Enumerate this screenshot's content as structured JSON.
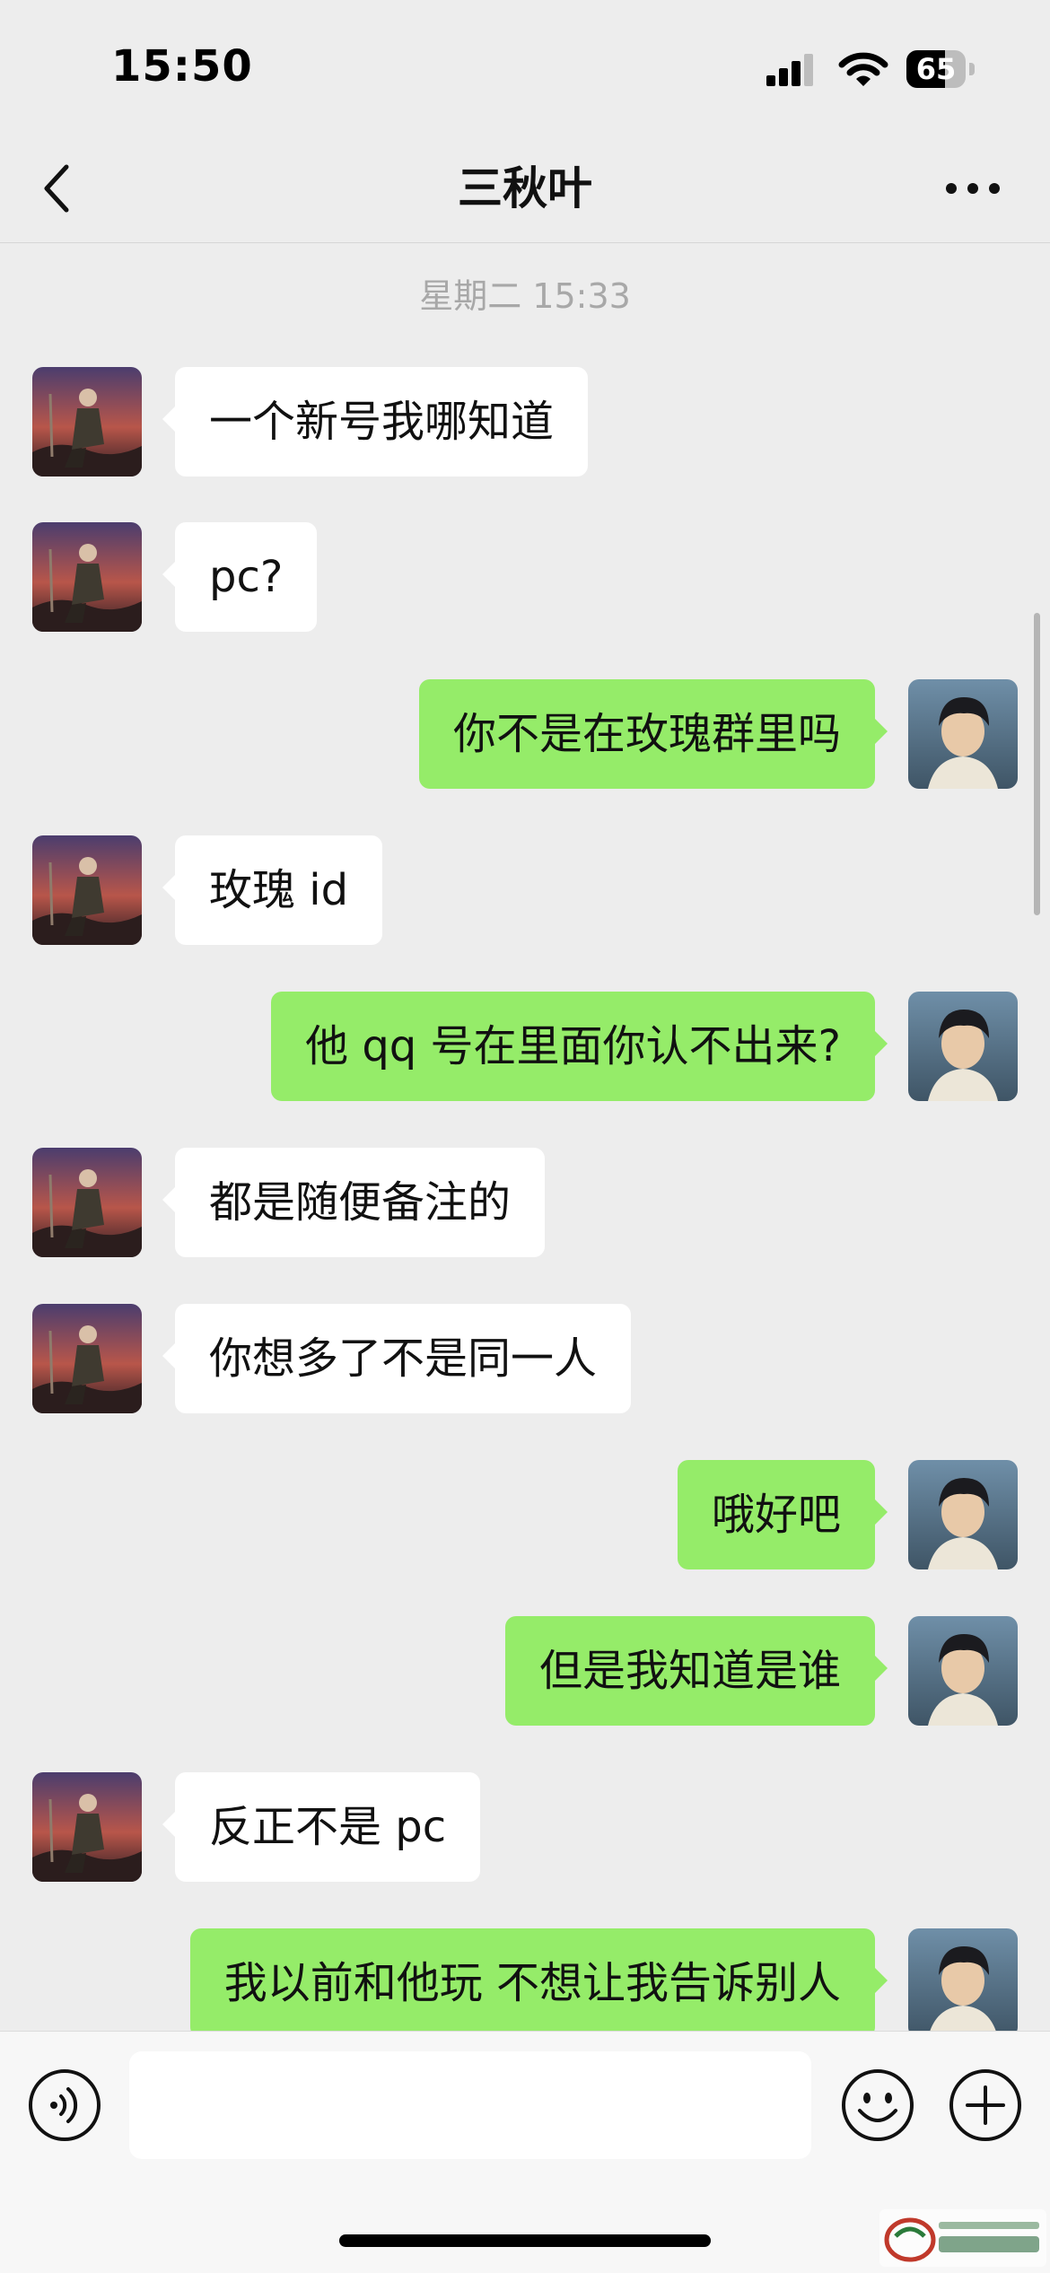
{
  "status_bar": {
    "time": "15:50",
    "battery_level": "65"
  },
  "header": {
    "title": "三秋叶"
  },
  "conversation": {
    "timestamp": "星期二 15:33",
    "messages": [
      {
        "side": "in",
        "text": "一个新号我哪知道"
      },
      {
        "side": "in",
        "text": "pc?"
      },
      {
        "side": "out",
        "text": "你不是在玫瑰群里吗"
      },
      {
        "side": "in",
        "text": "玫瑰 id"
      },
      {
        "side": "out",
        "text": "他 qq 号在里面你认不出来?"
      },
      {
        "side": "in",
        "text": "都是随便备注的"
      },
      {
        "side": "in",
        "text": "你想多了不是同一人"
      },
      {
        "side": "out",
        "text": "哦好吧"
      },
      {
        "side": "out",
        "text": "但是我知道是谁"
      },
      {
        "side": "in",
        "text": "反正不是 pc"
      },
      {
        "side": "out",
        "text": "我以前和他玩 不想让我告诉别人"
      }
    ]
  },
  "input_bar": {
    "placeholder": ""
  },
  "colors": {
    "background": "#ededed",
    "incoming_bubble": "#ffffff",
    "outgoing_bubble": "#95ec69"
  }
}
